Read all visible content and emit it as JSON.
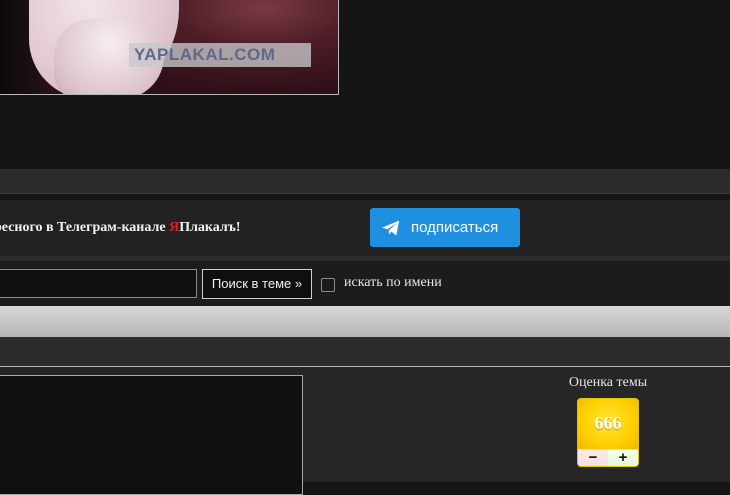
{
  "media": {
    "watermark": "YAPLAKAL.COM"
  },
  "telegram": {
    "text_before": "ресного в Телеграм-канале ",
    "brand_red": "Я",
    "brand_rest": "Плакалъ!",
    "button_label": "подписаться",
    "button_icon": "telegram-plane-icon",
    "button_color": "#1f8fe0"
  },
  "search": {
    "input_value": "",
    "button_label": "Поиск в теме »",
    "checkbox_label": "искать по имени",
    "checkbox_checked": false
  },
  "rating": {
    "title": "Оценка темы",
    "score": "666",
    "minus_label": "−",
    "plus_label": "+"
  }
}
